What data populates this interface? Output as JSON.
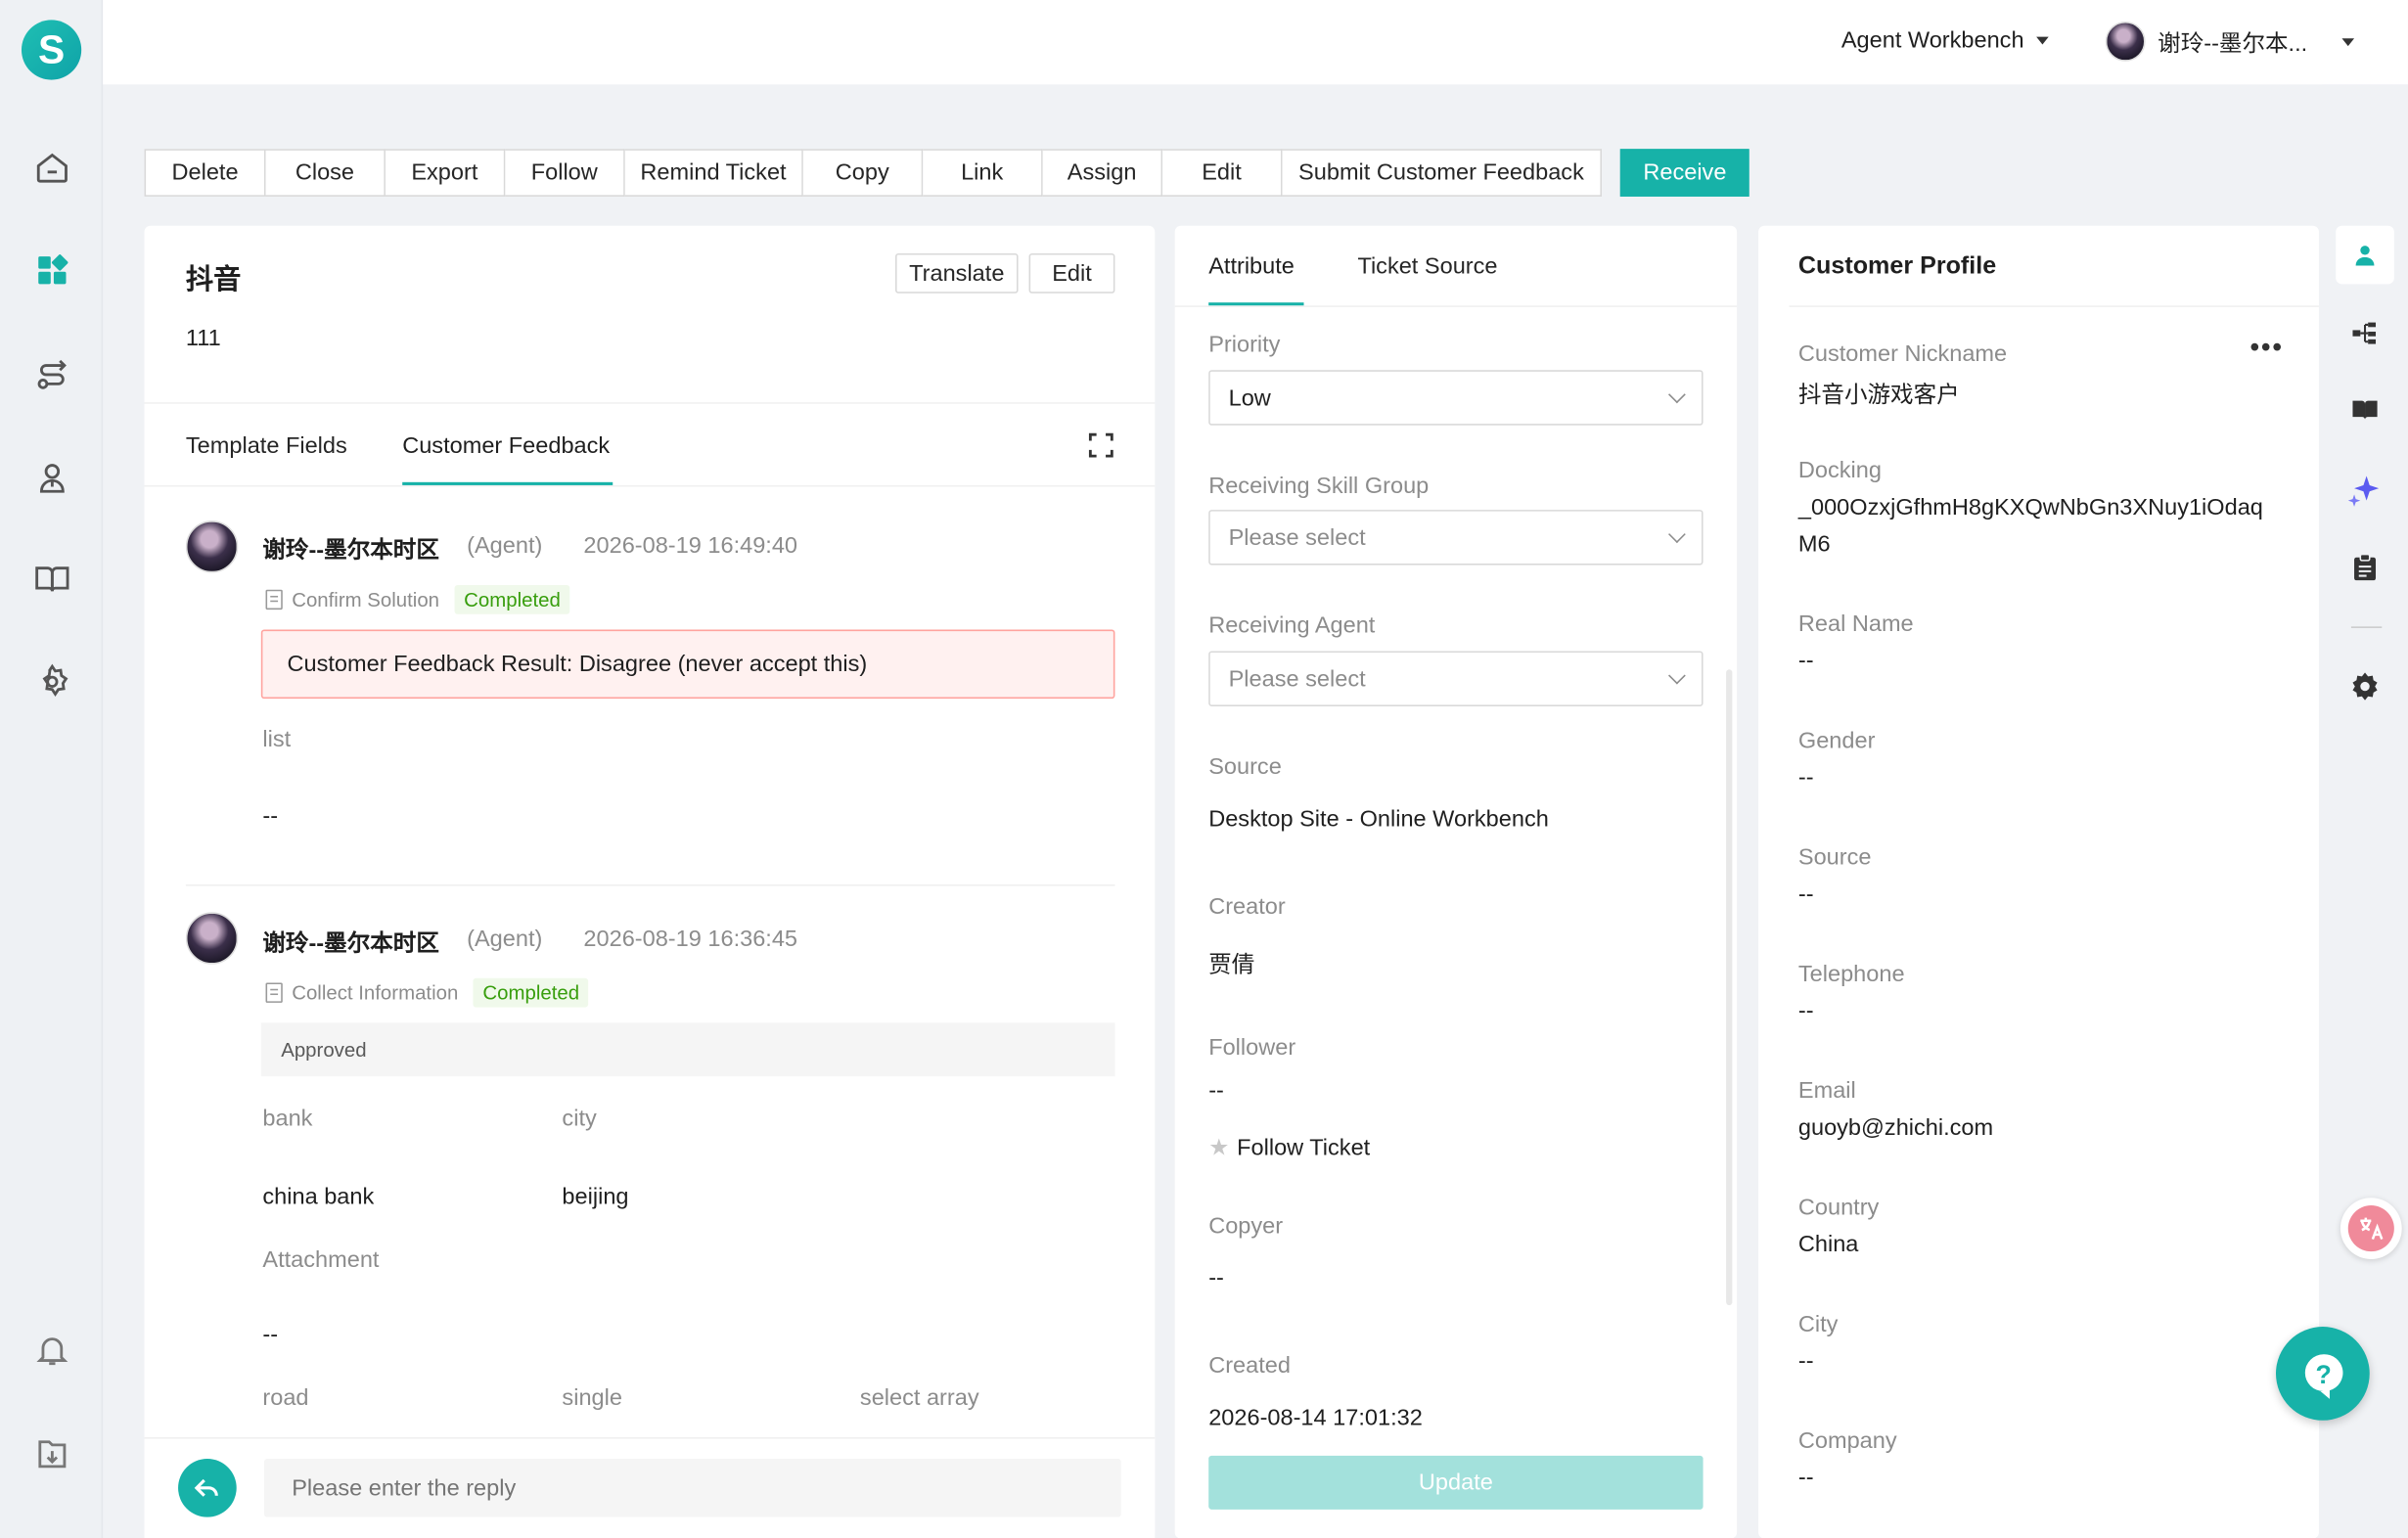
{
  "nav": {
    "logo": "S",
    "icons": [
      "home-icon",
      "dashboard-icon",
      "workflow-icon",
      "user-group-icon",
      "book-icon",
      "settings-icon",
      "bell-icon",
      "download-icon"
    ]
  },
  "topbar": {
    "workbench": "Agent Workbench",
    "user": "谢玲--墨尔本..."
  },
  "toolbar": {
    "buttons": [
      "Delete",
      "Close",
      "Export",
      "Follow",
      "Remind Ticket",
      "Copy",
      "Link",
      "Assign",
      "Edit",
      "Submit Customer Feedback"
    ],
    "receive": "Receive"
  },
  "ticket": {
    "title": "抖音",
    "content": "111",
    "translate": "Translate",
    "edit": "Edit"
  },
  "left_tabs": {
    "template_fields": "Template Fields",
    "customer_feedback": "Customer Feedback"
  },
  "feedback": [
    {
      "name": "谢玲--墨尔本时区",
      "role": "(Agent)",
      "time": "2026-08-19 16:49:40",
      "step": "Confirm Solution",
      "status": "Completed",
      "result": "Customer Feedback Result: Disagree (never accept this)",
      "field_label": "list",
      "field_value": "--"
    },
    {
      "name": "谢玲--墨尔本时区",
      "role": "(Agent)",
      "time": "2026-08-19 16:36:45",
      "step": "Collect Information",
      "status": "Completed",
      "approved": "Approved",
      "bank_label": "bank",
      "city_label": "city",
      "bank_value": "china bank",
      "city_value": "beijing",
      "attachment_label": "Attachment",
      "attachment_value": "--",
      "road_label": "road",
      "single_label": "single",
      "select_array_label": "select array"
    }
  ],
  "reply": {
    "placeholder": "Please enter the reply"
  },
  "attribute": {
    "tab_attribute": "Attribute",
    "tab_source": "Ticket Source",
    "priority_label": "Priority",
    "priority_value": "Low",
    "skill_group_label": "Receiving Skill Group",
    "skill_group_placeholder": "Please select",
    "agent_label": "Receiving Agent",
    "agent_placeholder": "Please select",
    "source_label": "Source",
    "source_value": "Desktop Site - Online Workbench",
    "creator_label": "Creator",
    "creator_value": "贾倩",
    "follower_label": "Follower",
    "follower_value": "--",
    "follow_ticket": "Follow Ticket",
    "copyer_label": "Copyer",
    "copyer_value": "--",
    "created_label": "Created",
    "created_value": "2026-08-14 17:01:32",
    "update": "Update"
  },
  "profile": {
    "title": "Customer Profile",
    "fields": [
      {
        "label": "Customer Nickname",
        "value": "抖音小游戏客户"
      },
      {
        "label": "Docking",
        "value": "_000OzxjGfhmH8gKXQwNbGn3XNuy1iOdaq",
        "value2": "M6"
      },
      {
        "label": "Real Name",
        "value": "--"
      },
      {
        "label": "Gender",
        "value": "--"
      },
      {
        "label": "Source",
        "value": "--"
      },
      {
        "label": "Telephone",
        "value": "--"
      },
      {
        "label": "Email",
        "value": "guoyb@zhichi.com"
      },
      {
        "label": "Country",
        "value": "China"
      },
      {
        "label": "City",
        "value": "--"
      },
      {
        "label": "Company",
        "value": "--"
      }
    ]
  },
  "right_rail": {
    "icons": [
      "person-icon",
      "tree-icon",
      "book-open-icon",
      "sparkle-icon",
      "clipboard-icon",
      "gear-icon",
      "translate-icon",
      "help-icon"
    ]
  },
  "colors": {
    "accent": "#17b2a8",
    "error_bg": "#fff1f0",
    "error_border": "#ffa39e"
  }
}
